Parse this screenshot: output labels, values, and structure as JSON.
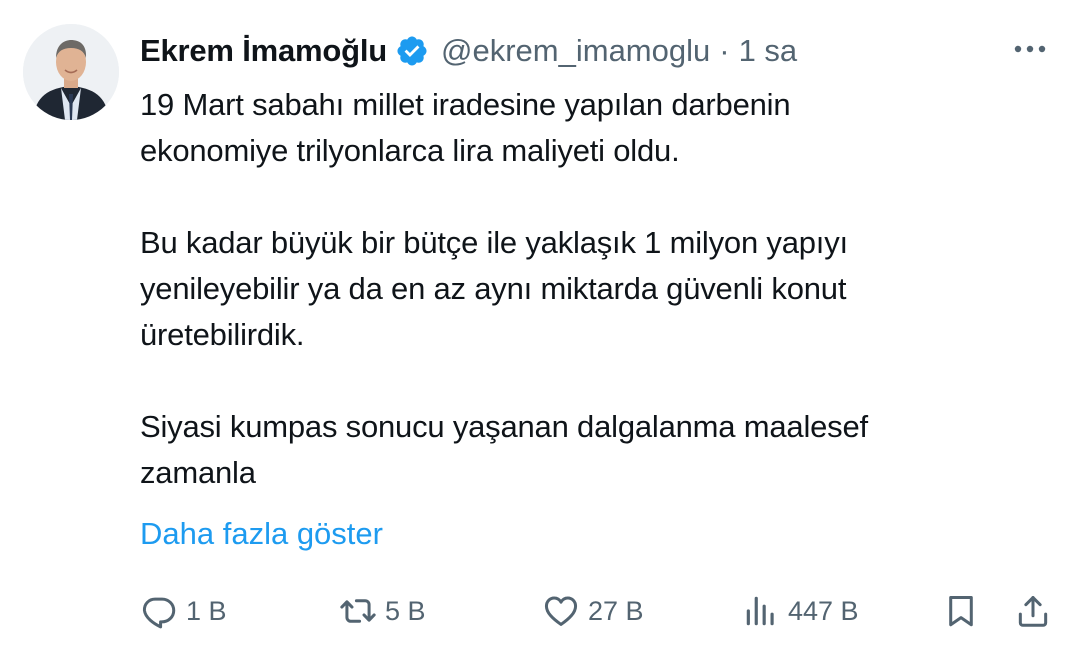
{
  "author": {
    "name": "Ekrem İmamoğlu",
    "handle": "@ekrem_imamoglu",
    "separator": "·",
    "time": "1 sa",
    "avatar_icon": "profile-photo",
    "verified_icon": "verified-badge-icon"
  },
  "tweet": {
    "text": "19 Mart sabahı millet iradesine yapılan darbenin\nekonomiye trilyonlarca lira maliyeti oldu.\n\nBu kadar büyük bir bütçe ile yaklaşık 1 milyon yapıyı\nyenileyebilir ya da en az aynı miktarda güvenli konut\nüretebilirdik.\n\nSiyasi kumpas sonucu yaşanan dalgalanma maalesef\nzamanla",
    "show_more": "Daha fazla göster"
  },
  "actions": {
    "reply": {
      "count": "1 B",
      "icon": "reply-icon"
    },
    "repost": {
      "count": "5 B",
      "icon": "repost-icon"
    },
    "like": {
      "count": "27 B",
      "icon": "heart-icon"
    },
    "views": {
      "count": "447 B",
      "icon": "views-icon"
    },
    "bookmark": {
      "icon": "bookmark-icon"
    },
    "share": {
      "icon": "share-icon"
    }
  },
  "colors": {
    "text": "#0f1419",
    "secondary": "#536471",
    "link": "#1d9bf0",
    "verified": "#1d9bf0"
  }
}
